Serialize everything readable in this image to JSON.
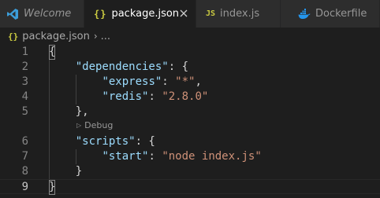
{
  "tabs": [
    {
      "label": "Welcome",
      "icon": "vscode-logo-icon",
      "active": false
    },
    {
      "label": "package.json",
      "icon": "json-braces-icon",
      "icon_text": "{}",
      "active": true
    },
    {
      "label": "index.js",
      "icon": "js-file-icon",
      "icon_text": "JS",
      "active": false
    },
    {
      "label": "Dockerfile",
      "icon": "docker-whale-icon",
      "active": false
    }
  ],
  "breadcrumb": {
    "icon_text": "{}",
    "file": "package.json",
    "separator": "›",
    "ellipsis": "..."
  },
  "codelens": {
    "play_glyph": "▷",
    "label": "Debug"
  },
  "lines": [
    {
      "number": "1",
      "tokens": [
        {
          "t": "punc",
          "v": "{"
        }
      ]
    },
    {
      "number": "2",
      "tokens": [
        {
          "t": "punc",
          "v": "    "
        },
        {
          "t": "key",
          "v": "\"dependencies\""
        },
        {
          "t": "punc",
          "v": ": {"
        }
      ]
    },
    {
      "number": "3",
      "tokens": [
        {
          "t": "punc",
          "v": "        "
        },
        {
          "t": "key",
          "v": "\"express\""
        },
        {
          "t": "punc",
          "v": ": "
        },
        {
          "t": "str",
          "v": "\"*\""
        },
        {
          "t": "punc",
          "v": ","
        }
      ]
    },
    {
      "number": "4",
      "tokens": [
        {
          "t": "punc",
          "v": "        "
        },
        {
          "t": "key",
          "v": "\"redis\""
        },
        {
          "t": "punc",
          "v": ": "
        },
        {
          "t": "str",
          "v": "\"2.8.0\""
        }
      ]
    },
    {
      "number": "5",
      "tokens": [
        {
          "t": "punc",
          "v": "    },"
        }
      ]
    },
    {
      "number": "6",
      "tokens": [
        {
          "t": "punc",
          "v": "    "
        },
        {
          "t": "key",
          "v": "\"scripts\""
        },
        {
          "t": "punc",
          "v": ": {"
        }
      ]
    },
    {
      "number": "7",
      "tokens": [
        {
          "t": "punc",
          "v": "        "
        },
        {
          "t": "key",
          "v": "\"start\""
        },
        {
          "t": "punc",
          "v": ": "
        },
        {
          "t": "str",
          "v": "\"node index.js\""
        }
      ]
    },
    {
      "number": "8",
      "tokens": [
        {
          "t": "punc",
          "v": "    }"
        }
      ]
    },
    {
      "number": "9",
      "tokens": [
        {
          "t": "punc",
          "v": "}"
        }
      ]
    }
  ],
  "colors": {
    "editor_bg": "#1e1e1e",
    "tabbar_bg": "#252526",
    "inactive_tab_bg": "#2d2d2d",
    "json_key": "#9cdcfe",
    "json_string": "#ce9178",
    "json_icon": "#cbcb41",
    "docker_icon": "#2496ed",
    "vscode_icon": "#3c9dd9"
  }
}
